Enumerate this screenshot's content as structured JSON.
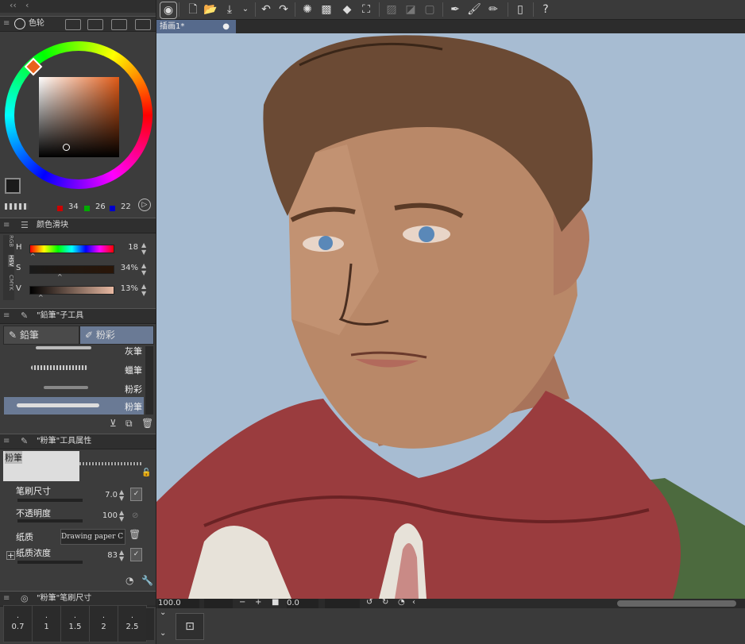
{
  "toolbar": {
    "icons": [
      "app-logo-icon",
      "new-file-icon",
      "open-file-icon",
      "save-icon",
      "undo-icon",
      "redo-icon",
      "loading-icon",
      "fill-icon",
      "transform-icon",
      "grid-icon",
      "snap-icon",
      "selection-icon",
      "pen-icon",
      "brush-icon",
      "ruler-icon",
      "phone-icon",
      "help-icon"
    ]
  },
  "panels": {
    "color_wheel": {
      "title": "色轮",
      "r": "34",
      "g": "26",
      "b": "22",
      "main_color": "#1a1a1a",
      "sub_color": "#ffffff"
    },
    "color_slider": {
      "title": "颜色滑块",
      "modes": [
        "RGB",
        "HSV",
        "CMYK"
      ],
      "h_label": "H",
      "h_value": "18",
      "s_label": "S",
      "s_value": "34%",
      "v_label": "V",
      "v_value": "13%"
    },
    "subtool": {
      "title": "\"鉛筆\"子工具",
      "group1": "鉛筆",
      "group2": "粉彩",
      "brushes": [
        "灰筆",
        "蠟筆",
        "粉彩",
        "粉筆"
      ],
      "selected": "粉筆"
    },
    "tool_property": {
      "title": "\"粉筆\"工具属性",
      "preview_label": "粉筆",
      "brush_size_label": "笔刷尺寸",
      "brush_size_value": "7.0",
      "opacity_label": "不透明度",
      "opacity_value": "100",
      "paper_label": "纸质",
      "paper_value": "Drawing paper C",
      "paper_density_label": "纸质浓度",
      "paper_density_value": "83"
    },
    "brush_size": {
      "title": "\"粉筆\"笔刷尺寸",
      "sizes": [
        "0.7",
        "1",
        "1.5",
        "2",
        "2.5"
      ]
    }
  },
  "canvas": {
    "tab_title": "插画1*",
    "zoom": "100.0",
    "angle": "0.0"
  }
}
